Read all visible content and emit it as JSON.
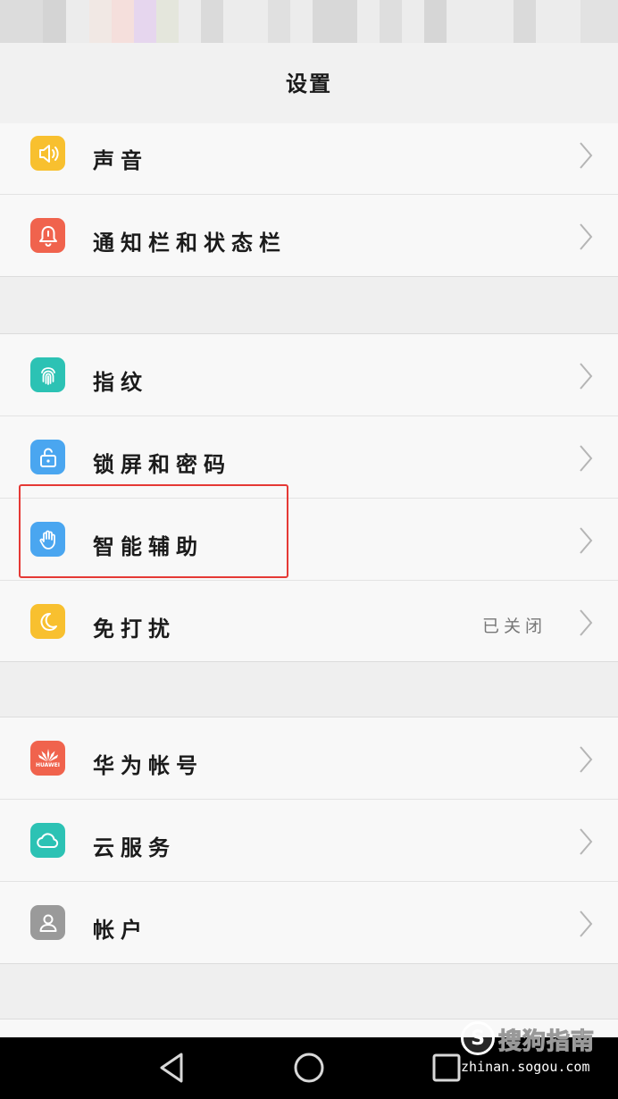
{
  "header": {
    "title": "设置"
  },
  "groups": [
    {
      "items": [
        {
          "label": "声音",
          "icon": "speaker-icon",
          "color": "#f8c02f"
        },
        {
          "label": "通知栏和状态栏",
          "icon": "bell-icon",
          "color": "#f0634d"
        }
      ]
    },
    {
      "items": [
        {
          "label": "指纹",
          "icon": "fingerprint-icon",
          "color": "#2cc2b4"
        },
        {
          "label": "锁屏和密码",
          "icon": "unlock-icon",
          "color": "#4aa6f0"
        },
        {
          "label": "智能辅助",
          "icon": "hand-icon",
          "color": "#4aa6f0"
        },
        {
          "label": "免打扰",
          "icon": "moon-icon",
          "color": "#f8c02f",
          "value": "已关闭"
        }
      ]
    },
    {
      "items": [
        {
          "label": "华为帐号",
          "icon": "huawei-logo-icon",
          "color": "#f0634d",
          "badge": "HUAWEI"
        },
        {
          "label": "云服务",
          "icon": "cloud-icon",
          "color": "#2cc2b4"
        },
        {
          "label": "帐户",
          "icon": "person-icon",
          "color": "#9a9a9a"
        }
      ]
    }
  ],
  "watermark": {
    "logo": "S",
    "name": "搜狗指南",
    "url": "zhinan.sogou.com"
  }
}
